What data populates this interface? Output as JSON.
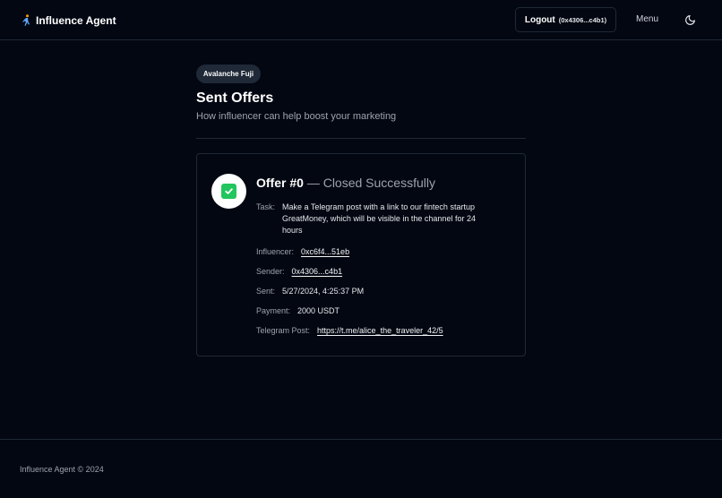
{
  "header": {
    "brand": "Influence Agent",
    "logout_label": "Logout",
    "logout_address": "(0x4306...c4b1)",
    "menu_label": "Menu",
    "brand_icon": "running-person-icon",
    "theme_icon": "moon-icon"
  },
  "main": {
    "network_badge": "Avalanche Fuji",
    "title": "Sent Offers",
    "subtitle": "How influencer can help boost your marketing"
  },
  "offer": {
    "name": "Offer #0",
    "status": "— Closed Successfully",
    "status_icon": "check-square-icon",
    "status_color": "#22c55e",
    "fields": {
      "task_label": "Task:",
      "task_value": "Make a Telegram post with a link to our fintech startup GreatMoney, which will be visible in the channel for 24 hours",
      "influencer_label": "Influencer:",
      "influencer_value": "0xc6f4...51eb",
      "sender_label": "Sender:",
      "sender_value": "0x4306...c4b1",
      "sent_label": "Sent:",
      "sent_value": "5/27/2024, 4:25:37 PM",
      "payment_label": "Payment:",
      "payment_value": "2000 USDT",
      "telegram_label": "Telegram Post:",
      "telegram_value": "https://t.me/alice_the_traveler_42/5"
    }
  },
  "footer": {
    "text": "Influence Agent © 2024"
  }
}
